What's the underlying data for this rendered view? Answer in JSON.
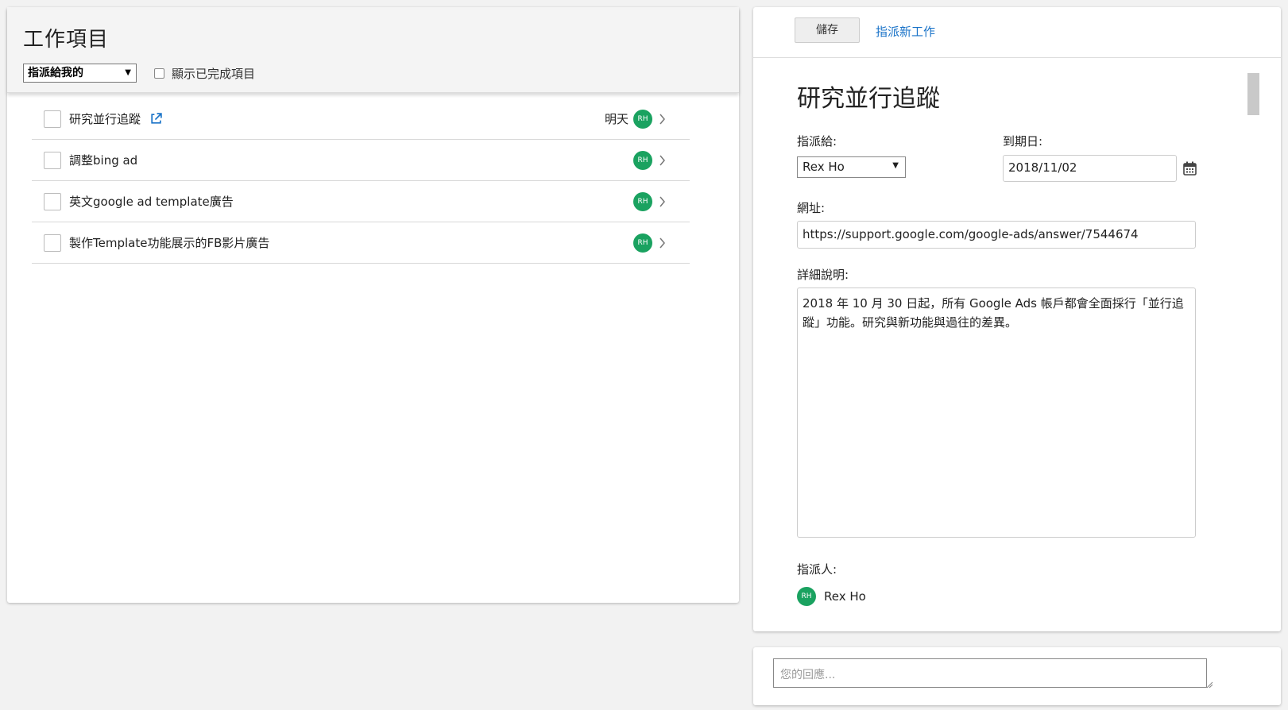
{
  "tasks_panel": {
    "title": "工作項目",
    "filter_select": "指派給我的",
    "show_completed_label": "顯示已完成項目",
    "items": [
      {
        "title": "研究並行追蹤",
        "due": "明天",
        "assignee_initials": "RH",
        "has_link": true
      },
      {
        "title": "調整bing ad",
        "due": "",
        "assignee_initials": "RH",
        "has_link": false
      },
      {
        "title": "英文google ad template廣告",
        "due": "",
        "assignee_initials": "RH",
        "has_link": false
      },
      {
        "title": "製作Template功能展示的FB影片廣告",
        "due": "",
        "assignee_initials": "RH",
        "has_link": false
      }
    ]
  },
  "detail_panel": {
    "save_label": "儲存",
    "assign_new_label": "指派新工作",
    "title": "研究並行追蹤",
    "assignee_label": "指派給:",
    "assignee_value": "Rex Ho",
    "due_label": "到期日:",
    "due_value": "2018/11/02",
    "url_label": "網址:",
    "url_value": "https://support.google.com/google-ads/answer/7544674",
    "desc_label": "詳細說明:",
    "desc_value": "2018 年 10 月 30 日起，所有 Google Ads 帳戶都會全面採行「並行追蹤」功能。研究與新功能與過往的差異。",
    "assigner_label": "指派人:",
    "assigner_initials": "RH",
    "assigner_name": "Rex Ho"
  },
  "reply": {
    "placeholder": "您的回應..."
  },
  "colors": {
    "avatar": "#1aa260",
    "link": "#1a73c8"
  }
}
